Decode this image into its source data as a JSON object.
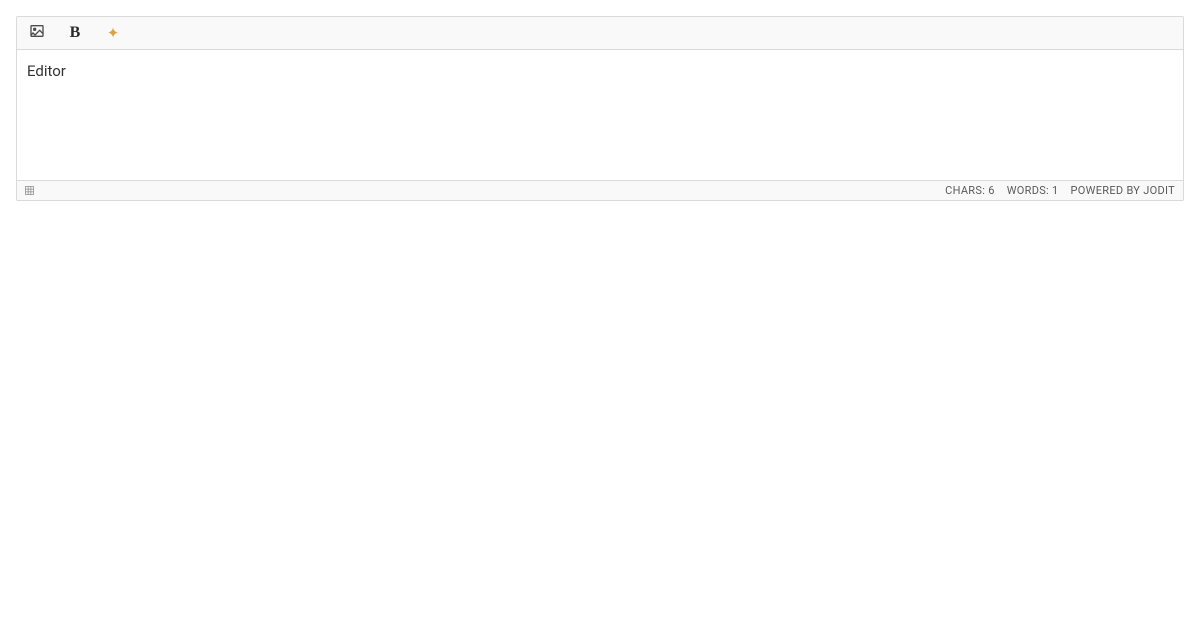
{
  "toolbar": {
    "image_icon": "image-icon",
    "bold_label": "B",
    "sparkle_label": "✦"
  },
  "editor": {
    "content": "Editor"
  },
  "statusbar": {
    "chars_label": "CHARS: 6",
    "words_label": "WORDS: 1",
    "powered_label": "POWERED BY JODIT"
  }
}
